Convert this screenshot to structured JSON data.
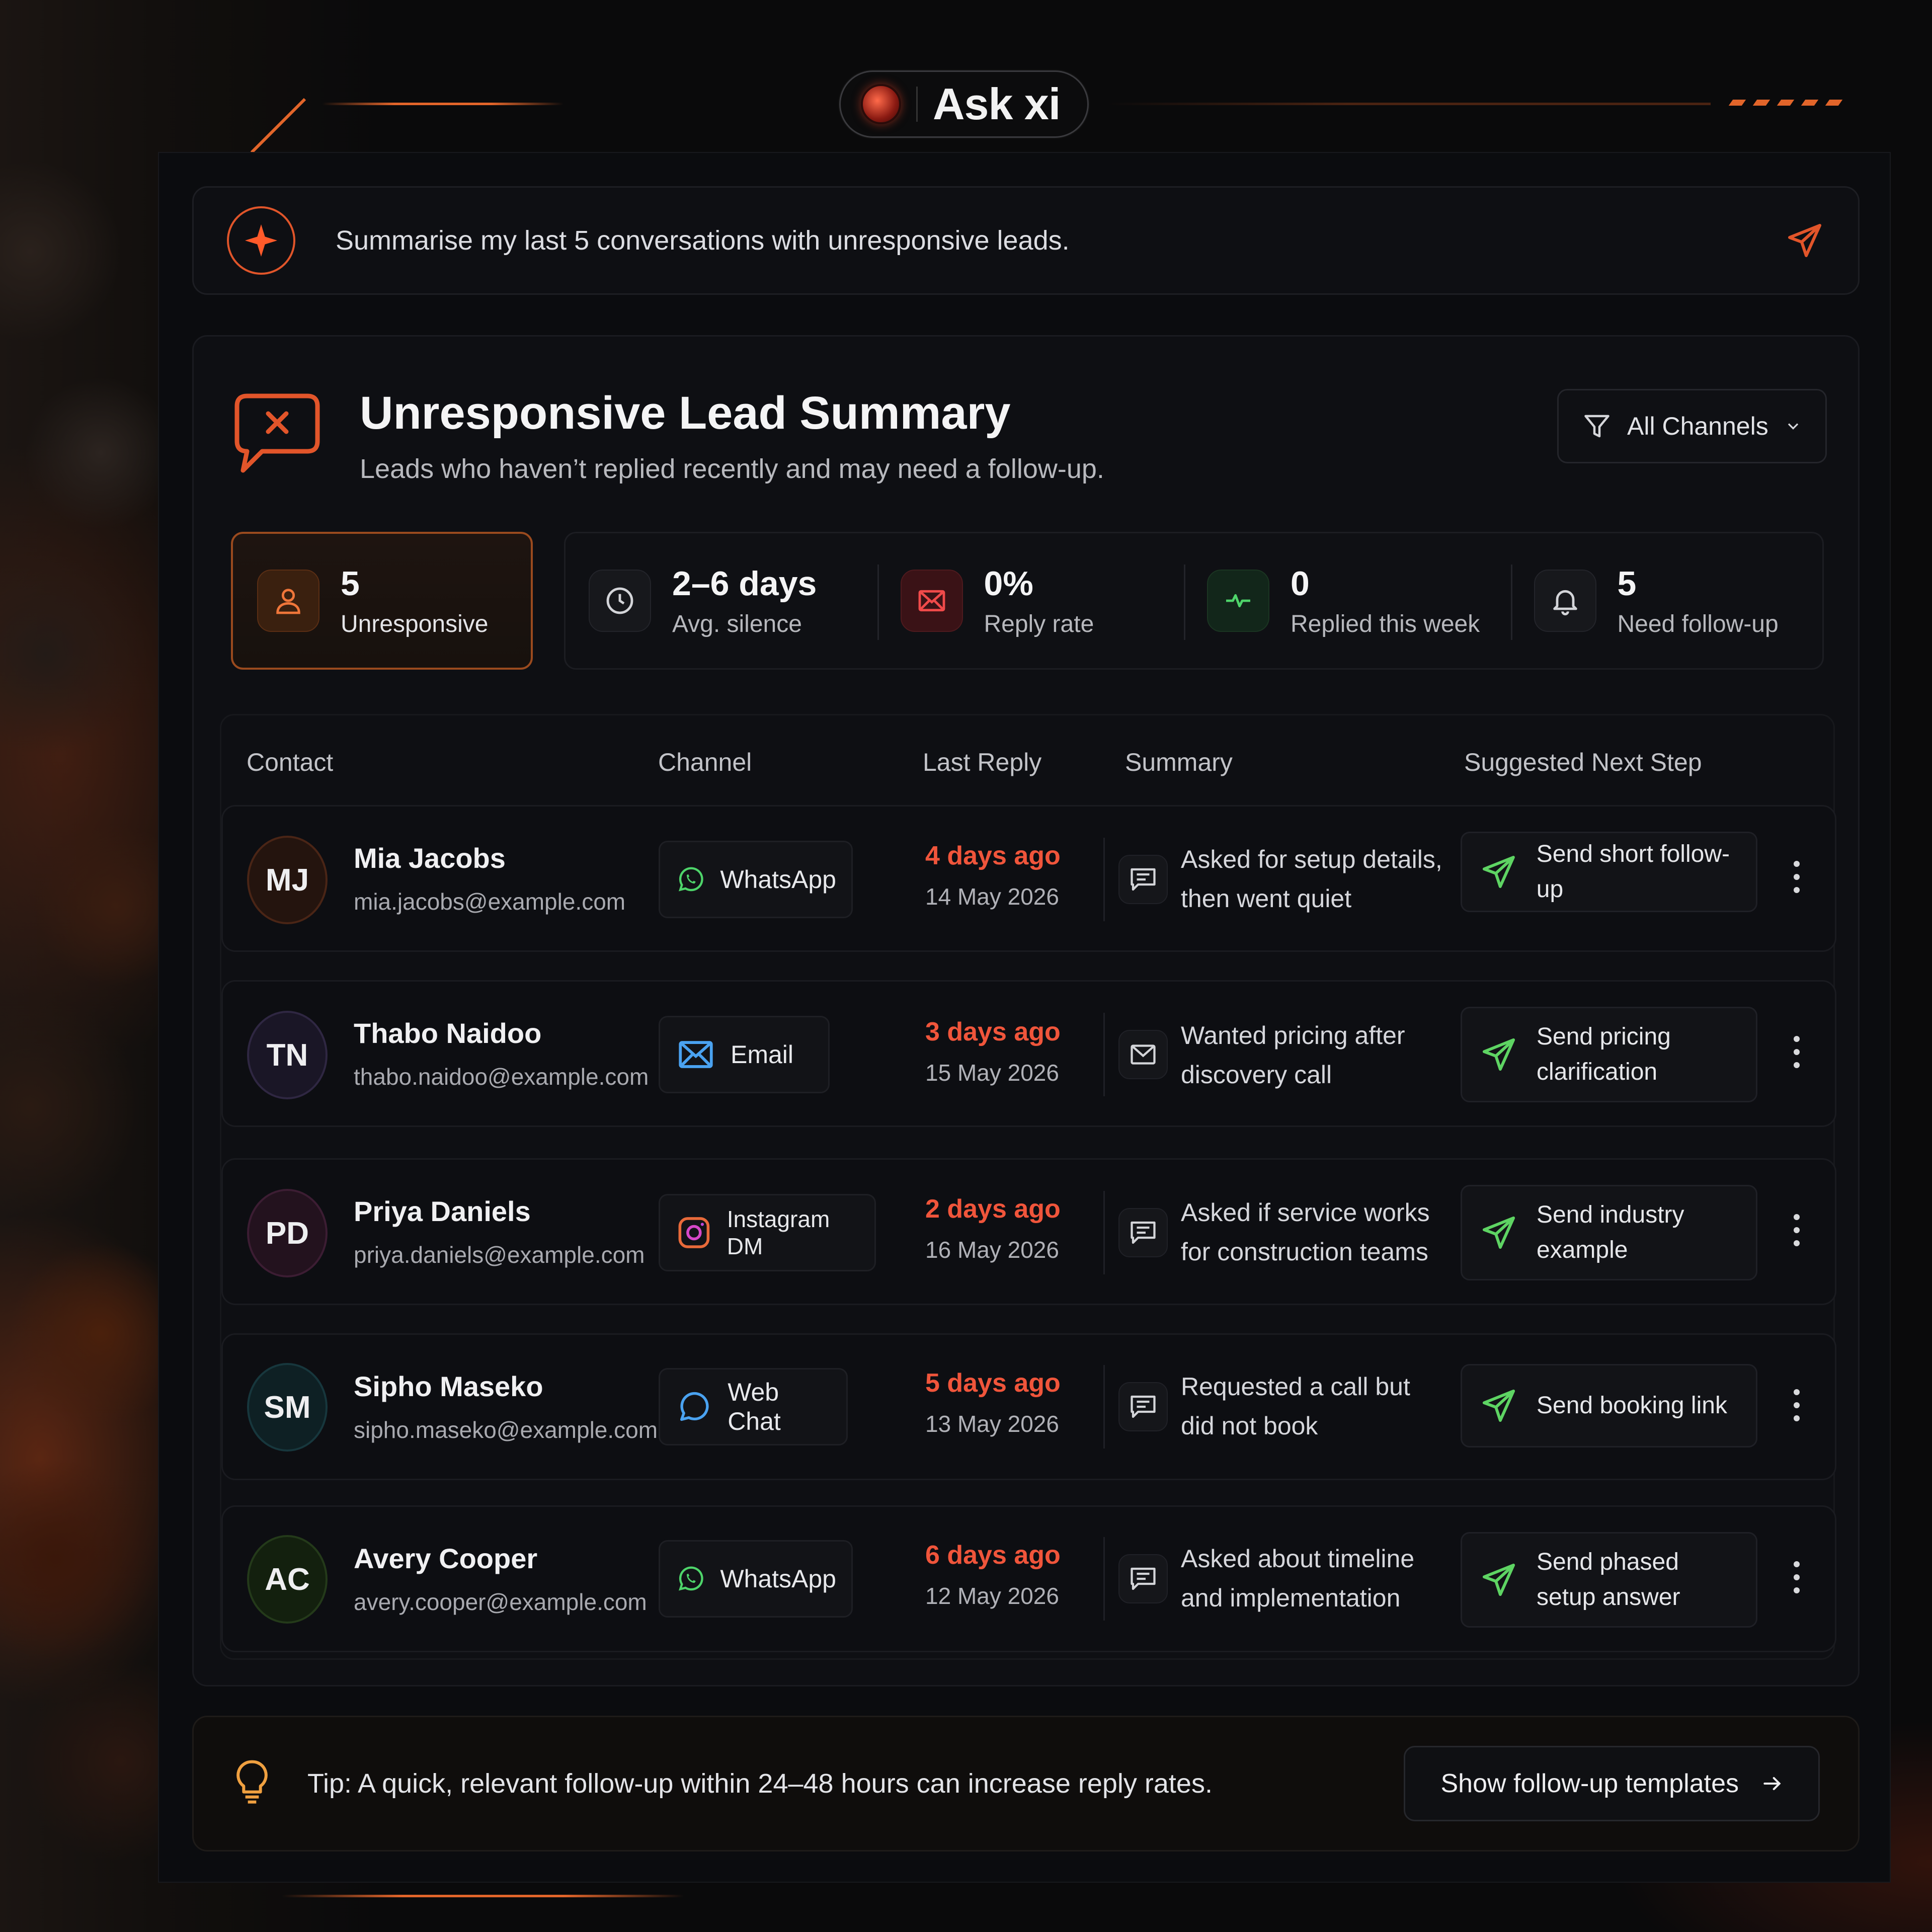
{
  "app": {
    "title": "Ask xi"
  },
  "prompt": {
    "text": "Summarise my last 5 conversations with unresponsive leads."
  },
  "card": {
    "title": "Unresponsive Lead Summary",
    "subtitle": "Leads who haven’t replied recently and may need a follow-up.",
    "filter_label": "All Channels"
  },
  "stats": [
    {
      "value": "5",
      "label": "Unresponsive",
      "icon": "user-icon"
    },
    {
      "value": "2–6 days",
      "label": "Avg. silence",
      "icon": "clock-icon"
    },
    {
      "value": "0%",
      "label": "Reply rate",
      "icon": "mail-x-icon"
    },
    {
      "value": "0",
      "label": "Replied this week",
      "icon": "activity-icon"
    },
    {
      "value": "5",
      "label": "Need follow-up",
      "icon": "bell-icon"
    }
  ],
  "table": {
    "headers": [
      "Contact",
      "Channel",
      "Last Reply",
      "Summary",
      "Suggested Next Step"
    ],
    "rows": [
      {
        "initials": "MJ",
        "name": "Mia Jacobs",
        "email": "mia.jacobs@example.com",
        "channel": "WhatsApp",
        "ago": "4 days ago",
        "date": "14 May 2026",
        "summary": "Asked for setup details, then went quiet",
        "next_step": "Send short follow-up"
      },
      {
        "initials": "TN",
        "name": "Thabo Naidoo",
        "email": "thabo.naidoo@example.com",
        "channel": "Email",
        "ago": "3 days ago",
        "date": "15 May 2026",
        "summary": "Wanted pricing after discovery call",
        "next_step": "Send pricing clarification"
      },
      {
        "initials": "PD",
        "name": "Priya Daniels",
        "email": "priya.daniels@example.com",
        "channel": "Instagram DM",
        "ago": "2 days ago",
        "date": "16 May 2026",
        "summary": "Asked if service works for construction teams",
        "next_step": "Send industry example"
      },
      {
        "initials": "SM",
        "name": "Sipho Maseko",
        "email": "sipho.maseko@example.com",
        "channel": "Web Chat",
        "ago": "5 days ago",
        "date": "13 May 2026",
        "summary": "Requested a call but did not book",
        "next_step": "Send booking link"
      },
      {
        "initials": "AC",
        "name": "Avery Cooper",
        "email": "avery.cooper@example.com",
        "channel": "WhatsApp",
        "ago": "6 days ago",
        "date": "12 May 2026",
        "summary": "Asked about timeline and implementation",
        "next_step": "Send phased setup answer"
      }
    ]
  },
  "tip": {
    "text": "Tip: A quick, relevant follow-up within 24–48 hours can increase reply rates.",
    "button_label": "Show follow-up templates"
  },
  "colors": {
    "accent": "#e2652a",
    "overdue": "#f0553b",
    "send_icon": "#5ed463"
  }
}
